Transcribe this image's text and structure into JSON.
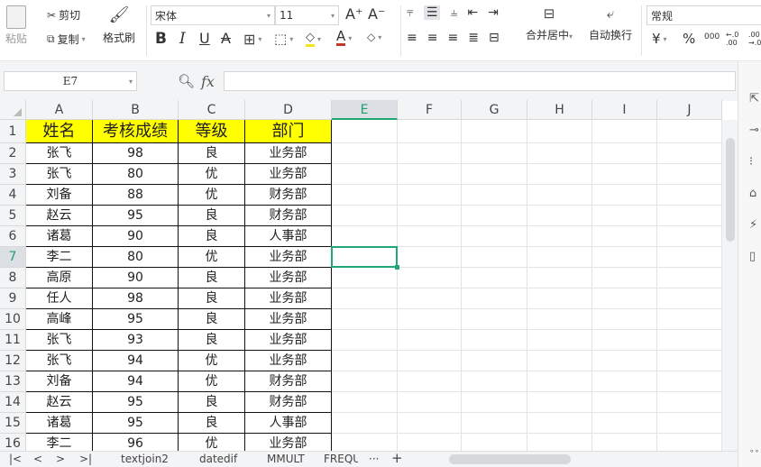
{
  "ribbon": {
    "paste": "粘贴",
    "cut": "剪切",
    "copy": "复制",
    "format_painter": "格式刷",
    "font_name": "宋体",
    "font_size": "11",
    "merge_center": "合并居中",
    "wrap_text": "自动换行",
    "number_format": "常规",
    "currency": "¥",
    "percent": "%",
    "thousands": "000",
    "inc_decimal": "←.0 .00",
    "dec_decimal": ".00 →.0",
    "bold": "B",
    "italic": "I",
    "underline": "U",
    "strike": "A",
    "font_color": "A",
    "grow": "A⁺",
    "shrink": "A⁻"
  },
  "formula_bar": {
    "name_box": "E7",
    "fx": "fx",
    "value": ""
  },
  "columns": [
    "A",
    "B",
    "C",
    "D",
    "E",
    "F",
    "G",
    "H",
    "I",
    "J"
  ],
  "active_cell": {
    "col": "E",
    "row": 7
  },
  "table": {
    "headers": [
      "姓名",
      "考核成绩",
      "等级",
      "部门"
    ],
    "rows": [
      [
        "张飞",
        "98",
        "良",
        "业务部"
      ],
      [
        "张飞",
        "80",
        "优",
        "业务部"
      ],
      [
        "刘备",
        "88",
        "优",
        "财务部"
      ],
      [
        "赵云",
        "95",
        "良",
        "财务部"
      ],
      [
        "诸葛",
        "90",
        "良",
        "人事部"
      ],
      [
        "李二",
        "80",
        "优",
        "业务部"
      ],
      [
        "高原",
        "90",
        "良",
        "业务部"
      ],
      [
        "任人",
        "98",
        "良",
        "业务部"
      ],
      [
        "高峰",
        "95",
        "良",
        "业务部"
      ],
      [
        "张飞",
        "93",
        "良",
        "业务部"
      ],
      [
        "张飞",
        "94",
        "优",
        "业务部"
      ],
      [
        "刘备",
        "94",
        "优",
        "财务部"
      ],
      [
        "赵云",
        "95",
        "良",
        "财务部"
      ],
      [
        "诸葛",
        "95",
        "良",
        "人事部"
      ],
      [
        "李二",
        "96",
        "优",
        "业务部"
      ]
    ]
  },
  "sheet_tabs": [
    "textjoin2",
    "datedif",
    "MMULT",
    "FREQU"
  ],
  "tab_more": "···",
  "tab_add": "+",
  "colors": {
    "header_fill": "#ffff00",
    "selection": "#21a675"
  }
}
